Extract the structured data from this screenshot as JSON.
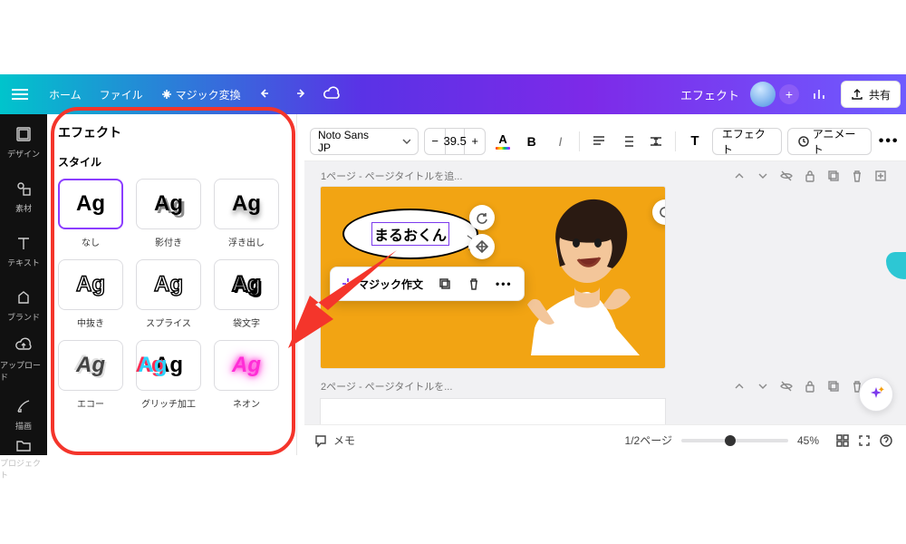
{
  "top": {
    "home": "ホーム",
    "file": "ファイル",
    "magic": "マジック変換",
    "doc_title": "エフェクト",
    "share": "共有"
  },
  "rail": {
    "design": "デザイン",
    "elements": "素材",
    "text": "テキスト",
    "brand": "ブランド",
    "upload": "アップロード",
    "draw": "描画",
    "project": "プロジェクト"
  },
  "panel": {
    "title": "エフェクト",
    "section_style": "スタイル",
    "styles": {
      "none": "なし",
      "shadow": "影付き",
      "lift": "浮き出し",
      "hollow": "中抜き",
      "splice": "スプライス",
      "bag": "袋文字",
      "echo": "エコー",
      "glitch": "グリッチ加工",
      "neon": "ネオン"
    },
    "sample": "Ag"
  },
  "toolbar": {
    "font": "Noto Sans JP",
    "size": "39.5",
    "minus": "−",
    "plus": "+",
    "letter": "A",
    "bold": "B",
    "italic": "I",
    "format_T": "T",
    "effects": "エフェクト",
    "animate": "アニメート",
    "more": "•••"
  },
  "pages": {
    "p1_label": "1ページ - ページタイトルを追...",
    "p2_label": "2ページ - ページタイトルを...",
    "speech_text": "まるおくん",
    "magic_write": "マジック作文"
  },
  "bottom": {
    "memo": "メモ",
    "page_counter": "1/2ページ",
    "zoom_pct": "45%"
  }
}
